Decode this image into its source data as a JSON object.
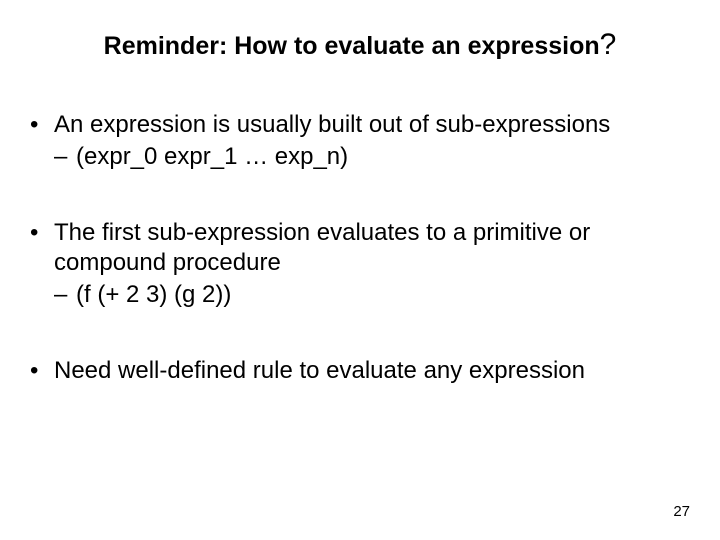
{
  "title": {
    "main": "Reminder: How to evaluate an expression",
    "qmark": "?"
  },
  "bullets": [
    {
      "text": "An expression is usually built out of sub-expressions",
      "sub": "(expr_0  expr_1 … exp_n)"
    },
    {
      "text": "The first sub-expression evaluates to a primitive or compound procedure",
      "sub": "(f  (+ 2 3) (g 2))"
    },
    {
      "text": "Need well-defined rule to evaluate any expression",
      "sub": null
    }
  ],
  "page_number": "27"
}
